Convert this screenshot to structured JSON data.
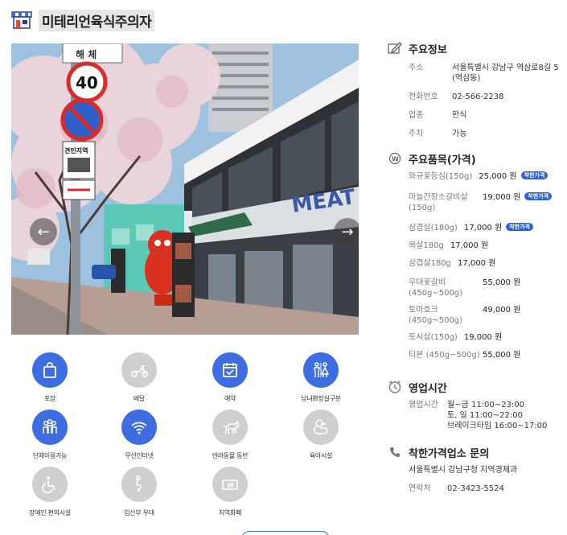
{
  "header": {
    "title": "미테리언육식주의자",
    "icon": "store-icon"
  },
  "photo": {
    "prev_icon": "←",
    "next_icon": "→",
    "sign_text": "해 체",
    "speed_limit": "40",
    "tow_sign": "견인지역",
    "building_sign": "MEAT"
  },
  "amenities": [
    {
      "label": "포장",
      "active": true,
      "icon": "bag-icon"
    },
    {
      "label": "배달",
      "active": false,
      "icon": "scooter-icon"
    },
    {
      "label": "예약",
      "active": true,
      "icon": "calendar-icon"
    },
    {
      "label": "남녀화장실구분",
      "active": true,
      "icon": "restroom-icon"
    },
    {
      "label": "단체이용가능",
      "active": true,
      "icon": "group-icon"
    },
    {
      "label": "무선인터넷",
      "active": true,
      "icon": "wifi-icon"
    },
    {
      "label": "반려동물 동반",
      "active": false,
      "icon": "pet-icon"
    },
    {
      "label": "육아시설",
      "active": false,
      "icon": "duck-icon"
    },
    {
      "label": "장애인 편의시설",
      "active": false,
      "icon": "wheelchair-icon"
    },
    {
      "label": "임산부 우대",
      "active": false,
      "icon": "pregnant-icon"
    },
    {
      "label": "지역화폐",
      "active": false,
      "icon": "money-icon"
    }
  ],
  "info": {
    "title": "주요정보",
    "address_label": "주소",
    "address_value": "서울특별시 강남구 역삼로8길 5 (역삼동)",
    "phone_label": "전화번호",
    "phone_value": "02-566-2238",
    "category_label": "업종",
    "category_value": "한식",
    "parking_label": "주차",
    "parking_value": "가능"
  },
  "menu": {
    "title": "주요품목(가격)",
    "badge_text": "착한가격",
    "items": [
      {
        "name": "와규꽃등심(150g)",
        "price": "25,000 원",
        "badge": true
      },
      {
        "name": "마늘간장소갈비살 (150g)",
        "price": "19,000 원",
        "badge": true
      },
      {
        "name": "삼겹살(180g)",
        "price": "17,000 원",
        "badge": true
      },
      {
        "name": "목살180g",
        "price": "17,000 원",
        "badge": false
      },
      {
        "name": "삼겹살180g",
        "price": "17,000 원",
        "badge": false
      },
      {
        "name": "우대꽃갈비 (450g~500g)",
        "price": "55,000 원",
        "badge": false
      },
      {
        "name": "토마호크 (450g~500g)",
        "price": "49,000 원",
        "badge": false
      },
      {
        "name": "토시살(150g)",
        "price": "19,000 원",
        "badge": false
      },
      {
        "name": "티본 (450g~500g)",
        "price": "55,000 원",
        "badge": false
      }
    ]
  },
  "hours": {
    "title": "영업시간",
    "label": "영업시간",
    "line1": "월~금 11:00~23:00",
    "line2": "토, 일 11:00~22:00",
    "line3": "브레이크타임 16:00~17:00"
  },
  "contact": {
    "title": "착한가격업소 문의",
    "org": "서울특별시 강남구청 지역경제과",
    "phone_label": "연락처",
    "phone_value": "02-3423-5524"
  },
  "colors": {
    "accent": "#3d6de0",
    "inactive": "#cfcfcf",
    "badge": "#2f5fd6"
  }
}
